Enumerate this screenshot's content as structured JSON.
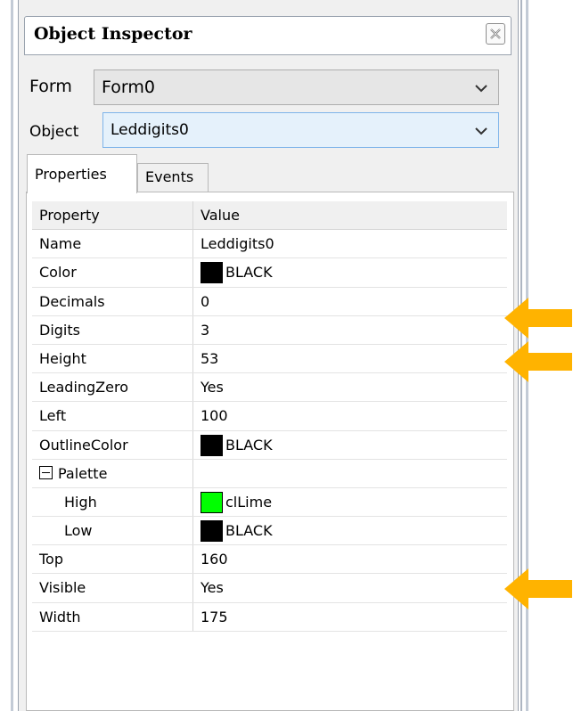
{
  "window": {
    "title": "Object Inspector"
  },
  "form_selector": {
    "label": "Form",
    "value": "Form0"
  },
  "object_selector": {
    "label": "Object",
    "value": "Leddigits0"
  },
  "tabs": [
    {
      "label": "Properties",
      "active": true
    },
    {
      "label": "Events",
      "active": false
    }
  ],
  "grid": {
    "headers": {
      "property": "Property",
      "value": "Value"
    },
    "rows": [
      {
        "property": "Name",
        "value": "Leddigits0"
      },
      {
        "property": "Color",
        "value": "BLACK",
        "swatch": "#000000"
      },
      {
        "property": "Decimals",
        "value": "0"
      },
      {
        "property": "Digits",
        "value": "3"
      },
      {
        "property": "Height",
        "value": "53"
      },
      {
        "property": "LeadingZero",
        "value": "Yes"
      },
      {
        "property": "Left",
        "value": "100"
      },
      {
        "property": "OutlineColor",
        "value": "BLACK",
        "swatch": "#000000"
      },
      {
        "property": "Palette",
        "value": "",
        "expanded": true
      },
      {
        "property": "High",
        "value": "clLime",
        "swatch": "#00ff00"
      },
      {
        "property": "Low",
        "value": "BLACK",
        "swatch": "#000000"
      },
      {
        "property": "Top",
        "value": "160"
      },
      {
        "property": "Visible",
        "value": "Yes"
      },
      {
        "property": "Width",
        "value": "175"
      }
    ]
  },
  "colors": {
    "arrow": "#ffb300",
    "selected_combo_border": "#7eb4ea"
  }
}
